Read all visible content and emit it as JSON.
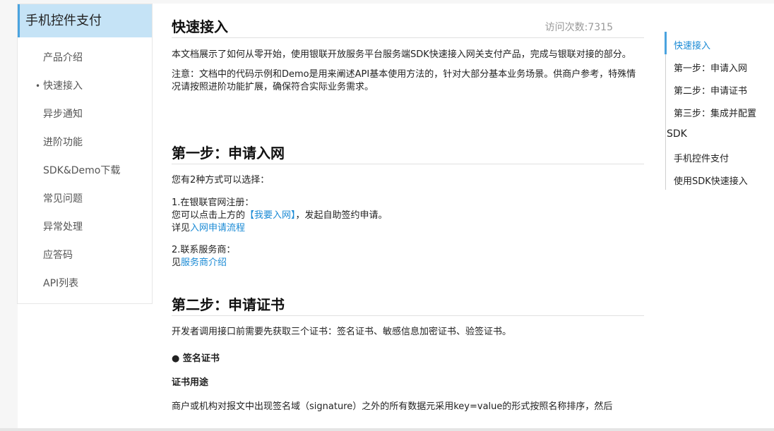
{
  "sidebar": {
    "title": "手机控件支付",
    "items": [
      {
        "label": "产品介绍"
      },
      {
        "label": "快速接入"
      },
      {
        "label": "异步通知"
      },
      {
        "label": "进阶功能"
      },
      {
        "label": "SDK&Demo下载"
      },
      {
        "label": "常见问题"
      },
      {
        "label": "异常处理"
      },
      {
        "label": "应答码"
      },
      {
        "label": "API列表"
      }
    ],
    "active_index": 1
  },
  "main": {
    "title": "快速接入",
    "visits": "访问次数:7315",
    "intro": "本文档展示了如何从零开始，使用银联开放服务平台服务端SDK快速接入网关支付产品，完成与银联对接的部分。",
    "note": "注意：文档中的代码示例和Demo是用来阐述API基本使用方法的，针对大部分基本业务场景。供商户参考，特殊情况请按照进阶功能扩展，确保符合实际业务需求。",
    "step1": {
      "heading": "第一步：申请入网",
      "lead": "您有2种方式可以选择：",
      "opt1_title": "1.在银联官网注册：",
      "opt1_text_a": "您可以点击上方的",
      "opt1_link": "【我要入网】",
      "opt1_text_b": "，发起自助签约申请。",
      "opt1_detail_prefix": "详见",
      "opt1_detail_link": "入网申请流程",
      "opt2_title": "2.联系服务商：",
      "opt2_prefix": "见",
      "opt2_link": "服务商介绍"
    },
    "step2": {
      "heading": "第二步：申请证书",
      "lead": "开发者调用接口前需要先获取三个证书：签名证书、敏感信息加密证书、验签证书。",
      "bullet": "● 签名证书",
      "subheading": "证书用途",
      "cut_text": "商户或机构对报文中出现签名域（signature）之外的所有数据元采用key=value的形式按照名称排序，然后"
    }
  },
  "toc": {
    "items": [
      {
        "label": "快速接入"
      },
      {
        "label": "第一步：申请入网"
      },
      {
        "label": "第二步：申请证书"
      },
      {
        "label": "第三步：集成并配置"
      }
    ],
    "sdk_label": "SDK",
    "sub_items": [
      {
        "label": "手机控件支付"
      },
      {
        "label": "使用SDK快速接入"
      }
    ]
  },
  "colors": {
    "accent": "#1a8ad5",
    "sidebar_header_bg": "#c5e3f6",
    "sidebar_header_border": "#4aa3df"
  }
}
